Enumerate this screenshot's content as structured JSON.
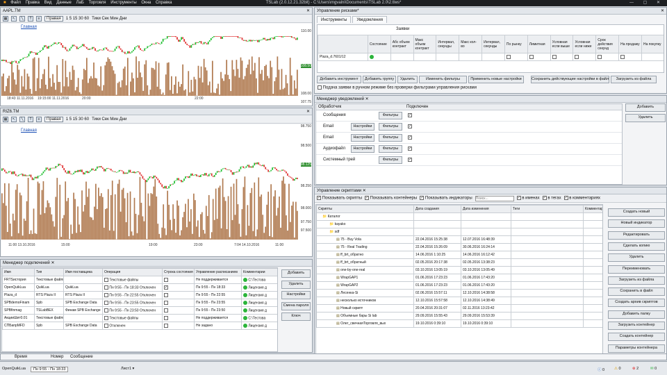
{
  "window": {
    "title": "TSLab (2.0.12.21.32bit) - C:\\Users\\mgvalni\\Documents\\TSLab 2.0\\2.tlws*"
  },
  "menu": [
    "Файл",
    "Правка",
    "Вид",
    "Данные",
    "ЛаБ",
    "Торговля",
    "Инструменты",
    "Окна",
    "Справка"
  ],
  "chart1": {
    "tab": "AAPL.TM",
    "position": "Правая",
    "timeframes": "1 5 15 30 60",
    "ticks_label": "Тики Сек Мин Дни",
    "pane_label": "Главная",
    "y_ticks": [
      "110.00",
      "108.00",
      "107.75"
    ],
    "x_ticks": [
      "18:43\n11.11.2016",
      "19:15:00\n11.11.2016",
      "20:00",
      "22:00"
    ],
    "last_price": "108.50"
  },
  "chart2": {
    "tab": "RIZ6.TM",
    "position": "Правая",
    "timeframes": "1 5 15 30 60",
    "ticks_label": "Тики Сек Мин Дни",
    "pane_label": "Главная",
    "y_ticks": [
      "98.750",
      "98.500",
      "98.250",
      "98.000",
      "97.750",
      "97.500"
    ],
    "x_ticks": [
      "11:00\n13.10.2016",
      "15:00",
      "19:00",
      "23:00",
      "7:04\n14.10.2016",
      "11:00"
    ],
    "last_price": "98.125"
  },
  "risk": {
    "title": "Управление рисками*",
    "tabs": [
      "Инструменты",
      "Уведомления"
    ],
    "group_header": "Заявки",
    "columns": [
      "Состояние",
      "Абс объем контракт",
      "Макс объем контракт",
      "Интервал, секунды",
      "Макс кол-во",
      "Интервал, секунды",
      "По рынку",
      "Лимитная",
      "Условная если выше",
      "Условная если ниже",
      "Срок действия секунд",
      "На продажу",
      "На покупку"
    ],
    "row_name": "Plaza_d.7601/12",
    "buttons": [
      "Добавить инструмент",
      "Добавить группу",
      "Удалить",
      "Изменить фильтры",
      "Применить новые настройки",
      "Сохранить действующие настройки в файл",
      "Загрузить из файла"
    ],
    "checkbox": "Подача заявки в ручном режиме без проверки фильтрами управления рисками"
  },
  "notify": {
    "title": "Менеджер уведомлений",
    "col_handler": "Обработчик",
    "col_connected": "Подключен",
    "rows": [
      {
        "name": "Сообщения",
        "settings": "",
        "filters": "Фильтры"
      },
      {
        "name": "Email",
        "settings": "Настройки",
        "filters": "Фильтры"
      },
      {
        "name": "Email",
        "settings": "Настройки",
        "filters": "Фильтры"
      },
      {
        "name": "Аудиофайл",
        "settings": "Настройки",
        "filters": "Фильтры"
      },
      {
        "name": "Системный трей",
        "settings": "",
        "filters": "Фильтры"
      }
    ],
    "add": "Добавить",
    "remove": "Удалить"
  },
  "scripts": {
    "title": "Управление скриптами",
    "toggles": [
      "Показывать скрипты",
      "Показывать контейнеры",
      "Показывать индикаторы"
    ],
    "search_placeholder": "Поиск...",
    "filters": [
      "в именах",
      "в тегах",
      "в комментариях"
    ],
    "columns": [
      "Скрипты",
      "Дата создания",
      "Дата изменения",
      "Теги",
      "Комментарии"
    ],
    "rows": [
      {
        "name": "Каталог",
        "created": "",
        "modified": "",
        "level": 0
      },
      {
        "name": "kayako",
        "created": "",
        "modified": "",
        "level": 1
      },
      {
        "name": "sdf",
        "created": "",
        "modified": "",
        "level": 1
      },
      {
        "name": "75 - Buy Vola",
        "created": "22.04.2016 15:25:38",
        "modified": "12.07.2016 16:48:39",
        "level": 2
      },
      {
        "name": "75 - Real Trading",
        "created": "22.04.2016 15:26:09",
        "modified": "30.06.2016 16:24:14",
        "level": 2
      },
      {
        "name": "ff_brt_обратно",
        "created": "14.06.2016 1:10:25",
        "modified": "14.06.2016 16:12:42",
        "level": 2
      },
      {
        "name": "ff_brt_обратный",
        "created": "02.05.2016 20:17:38",
        "modified": "02.05.2016 13:38:23",
        "level": 2
      },
      {
        "name": "one-by-one-real",
        "created": "03.10.2016 13:05:19",
        "modified": "03.10.2016 13:05:49",
        "level": 2
      },
      {
        "name": "WrapGAP1",
        "created": "01.06.2016 17:23:23",
        "modified": "01.06.2016 17:43:20",
        "level": 2
      },
      {
        "name": "WrapGAP2",
        "created": "01.06.2016 17:23:23",
        "modified": "01.06.2016 17:43:20",
        "level": 2
      },
      {
        "name": "Лесенка-Si",
        "created": "02.06.2016 15:57:11",
        "modified": "12.10.2016 14:38:58",
        "level": 2
      },
      {
        "name": "несколько источников",
        "created": "12.10.2016 15:57:58",
        "modified": "12.10.2016 14:38:49",
        "level": 2
      },
      {
        "name": "Новый скрипт",
        "created": "20.04.2016 20:31:07",
        "modified": "02.11.2016 13:23:42",
        "level": 2
      },
      {
        "name": "Объемные бары Si lab",
        "created": "29.09.2016 15:55:43",
        "modified": "29.09.2016 15:53:39",
        "level": 2
      },
      {
        "name": "Олег_свечнаяТорговля_вых",
        "created": "19.10.2016 0:39:10",
        "modified": "19.10.2016 0:39:10",
        "level": 2
      }
    ],
    "buttons": [
      "Создать новый",
      "Новый индикатор",
      "Редактировать",
      "Сделать копию",
      "Удалить",
      "Переименовать",
      "Загрузить из файла",
      "Сохранить в файл",
      "Создать архив скриптов",
      "Добавить папку",
      "Загрузить контейнер",
      "Создать контейнер",
      "Параметры контейнера"
    ]
  },
  "connections": {
    "title": "Менеджер подключений",
    "columns": [
      "Имя",
      "Тип",
      "Имя поставщика",
      "Операция",
      "Строка состояния",
      "Управление расписанием",
      "Комментарии"
    ],
    "rows": [
      {
        "name": "FRTSистория",
        "type": "Текстовые файлы",
        "provider": "",
        "op": "Текстовые файлы",
        "state": "",
        "sched": "Не поддерживается",
        "comment": "C:\\Тестова"
      },
      {
        "name": "OpenQuikLua",
        "type": "QuikLua",
        "provider": "QuikLua",
        "op": "Пн 9:55 - Пн 18:33 Отключен",
        "state": "✓",
        "sched": "Пн 9:55 - Пн 18:33",
        "comment": "Лицензия д"
      },
      {
        "name": "Plaza_d",
        "type": "RTS Plaza II",
        "provider": "RTS Plaza II",
        "op": "Пн 9:55 - Пн 22:55 Отключен",
        "state": "",
        "sched": "Пн 9:55 - Пн 22:55",
        "comment": "Лицензия д"
      },
      {
        "name": "SPBdemoFinam",
        "type": "Spb",
        "provider": "SPB Exchange Data",
        "op": "Пн 9:55 - Пн 23:55 Отключен",
        "state": "",
        "sched": "Пн 9:55 - Пн 23:55",
        "comment": "Лицензия д"
      },
      {
        "name": "SPBfinmag",
        "type": "TSLabBEX",
        "provider": "Финам SPB Exchange",
        "op": "Пн 9:55 - Пн 23:50 Отключен",
        "state": "",
        "sched": "Пн 9:55 - Пн 23:50",
        "comment": "Лицензия д"
      },
      {
        "name": "АкцииШит0.01",
        "type": "Текстовые файлы",
        "provider": "",
        "op": "Текстовые файлы",
        "state": "",
        "sched": "Не поддерживается",
        "comment": "C:\\Тестова"
      },
      {
        "name": "СПБапрМFD",
        "type": "Spb",
        "provider": "SPB Exchange Data",
        "op": "Отключен",
        "state": "",
        "sched": "Не задано",
        "comment": "Лицензия д"
      }
    ],
    "buttons": [
      "Добавить",
      "Удалить",
      "Настройки",
      "Смена пароля",
      "Ключ"
    ]
  },
  "messages": {
    "columns": [
      "Время",
      "Номер",
      "Сообщение"
    ]
  },
  "statusbar": {
    "connection": "OpenQuikLua",
    "schedule": "Пн 9:55 - Пн 18:33",
    "sheet": "Лист1",
    "counts": [
      "0",
      "0",
      "2",
      "0"
    ]
  }
}
